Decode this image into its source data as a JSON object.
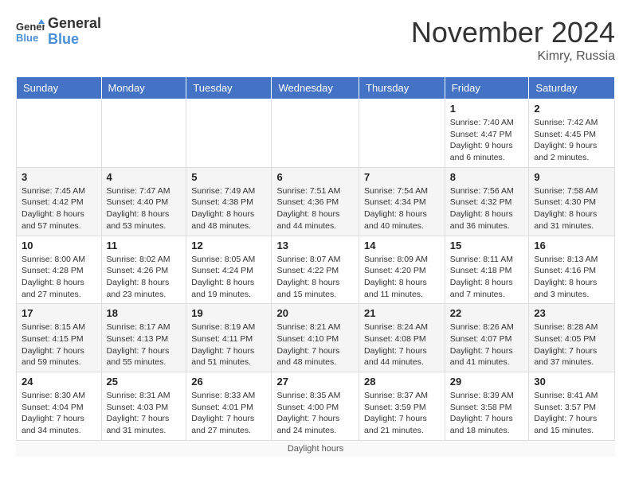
{
  "logo": {
    "line1": "General",
    "line2": "Blue"
  },
  "title": "November 2024",
  "location": "Kimry, Russia",
  "days_of_week": [
    "Sunday",
    "Monday",
    "Tuesday",
    "Wednesday",
    "Thursday",
    "Friday",
    "Saturday"
  ],
  "daylight_label": "Daylight hours",
  "weeks": [
    [
      {
        "day": "",
        "info": ""
      },
      {
        "day": "",
        "info": ""
      },
      {
        "day": "",
        "info": ""
      },
      {
        "day": "",
        "info": ""
      },
      {
        "day": "",
        "info": ""
      },
      {
        "day": "1",
        "info": "Sunrise: 7:40 AM\nSunset: 4:47 PM\nDaylight: 9 hours\nand 6 minutes."
      },
      {
        "day": "2",
        "info": "Sunrise: 7:42 AM\nSunset: 4:45 PM\nDaylight: 9 hours\nand 2 minutes."
      }
    ],
    [
      {
        "day": "3",
        "info": "Sunrise: 7:45 AM\nSunset: 4:42 PM\nDaylight: 8 hours\nand 57 minutes."
      },
      {
        "day": "4",
        "info": "Sunrise: 7:47 AM\nSunset: 4:40 PM\nDaylight: 8 hours\nand 53 minutes."
      },
      {
        "day": "5",
        "info": "Sunrise: 7:49 AM\nSunset: 4:38 PM\nDaylight: 8 hours\nand 48 minutes."
      },
      {
        "day": "6",
        "info": "Sunrise: 7:51 AM\nSunset: 4:36 PM\nDaylight: 8 hours\nand 44 minutes."
      },
      {
        "day": "7",
        "info": "Sunrise: 7:54 AM\nSunset: 4:34 PM\nDaylight: 8 hours\nand 40 minutes."
      },
      {
        "day": "8",
        "info": "Sunrise: 7:56 AM\nSunset: 4:32 PM\nDaylight: 8 hours\nand 36 minutes."
      },
      {
        "day": "9",
        "info": "Sunrise: 7:58 AM\nSunset: 4:30 PM\nDaylight: 8 hours\nand 31 minutes."
      }
    ],
    [
      {
        "day": "10",
        "info": "Sunrise: 8:00 AM\nSunset: 4:28 PM\nDaylight: 8 hours\nand 27 minutes."
      },
      {
        "day": "11",
        "info": "Sunrise: 8:02 AM\nSunset: 4:26 PM\nDaylight: 8 hours\nand 23 minutes."
      },
      {
        "day": "12",
        "info": "Sunrise: 8:05 AM\nSunset: 4:24 PM\nDaylight: 8 hours\nand 19 minutes."
      },
      {
        "day": "13",
        "info": "Sunrise: 8:07 AM\nSunset: 4:22 PM\nDaylight: 8 hours\nand 15 minutes."
      },
      {
        "day": "14",
        "info": "Sunrise: 8:09 AM\nSunset: 4:20 PM\nDaylight: 8 hours\nand 11 minutes."
      },
      {
        "day": "15",
        "info": "Sunrise: 8:11 AM\nSunset: 4:18 PM\nDaylight: 8 hours\nand 7 minutes."
      },
      {
        "day": "16",
        "info": "Sunrise: 8:13 AM\nSunset: 4:16 PM\nDaylight: 8 hours\nand 3 minutes."
      }
    ],
    [
      {
        "day": "17",
        "info": "Sunrise: 8:15 AM\nSunset: 4:15 PM\nDaylight: 7 hours\nand 59 minutes."
      },
      {
        "day": "18",
        "info": "Sunrise: 8:17 AM\nSunset: 4:13 PM\nDaylight: 7 hours\nand 55 minutes."
      },
      {
        "day": "19",
        "info": "Sunrise: 8:19 AM\nSunset: 4:11 PM\nDaylight: 7 hours\nand 51 minutes."
      },
      {
        "day": "20",
        "info": "Sunrise: 8:21 AM\nSunset: 4:10 PM\nDaylight: 7 hours\nand 48 minutes."
      },
      {
        "day": "21",
        "info": "Sunrise: 8:24 AM\nSunset: 4:08 PM\nDaylight: 7 hours\nand 44 minutes."
      },
      {
        "day": "22",
        "info": "Sunrise: 8:26 AM\nSunset: 4:07 PM\nDaylight: 7 hours\nand 41 minutes."
      },
      {
        "day": "23",
        "info": "Sunrise: 8:28 AM\nSunset: 4:05 PM\nDaylight: 7 hours\nand 37 minutes."
      }
    ],
    [
      {
        "day": "24",
        "info": "Sunrise: 8:30 AM\nSunset: 4:04 PM\nDaylight: 7 hours\nand 34 minutes."
      },
      {
        "day": "25",
        "info": "Sunrise: 8:31 AM\nSunset: 4:03 PM\nDaylight: 7 hours\nand 31 minutes."
      },
      {
        "day": "26",
        "info": "Sunrise: 8:33 AM\nSunset: 4:01 PM\nDaylight: 7 hours\nand 27 minutes."
      },
      {
        "day": "27",
        "info": "Sunrise: 8:35 AM\nSunset: 4:00 PM\nDaylight: 7 hours\nand 24 minutes."
      },
      {
        "day": "28",
        "info": "Sunrise: 8:37 AM\nSunset: 3:59 PM\nDaylight: 7 hours\nand 21 minutes."
      },
      {
        "day": "29",
        "info": "Sunrise: 8:39 AM\nSunset: 3:58 PM\nDaylight: 7 hours\nand 18 minutes."
      },
      {
        "day": "30",
        "info": "Sunrise: 8:41 AM\nSunset: 3:57 PM\nDaylight: 7 hours\nand 15 minutes."
      }
    ]
  ]
}
